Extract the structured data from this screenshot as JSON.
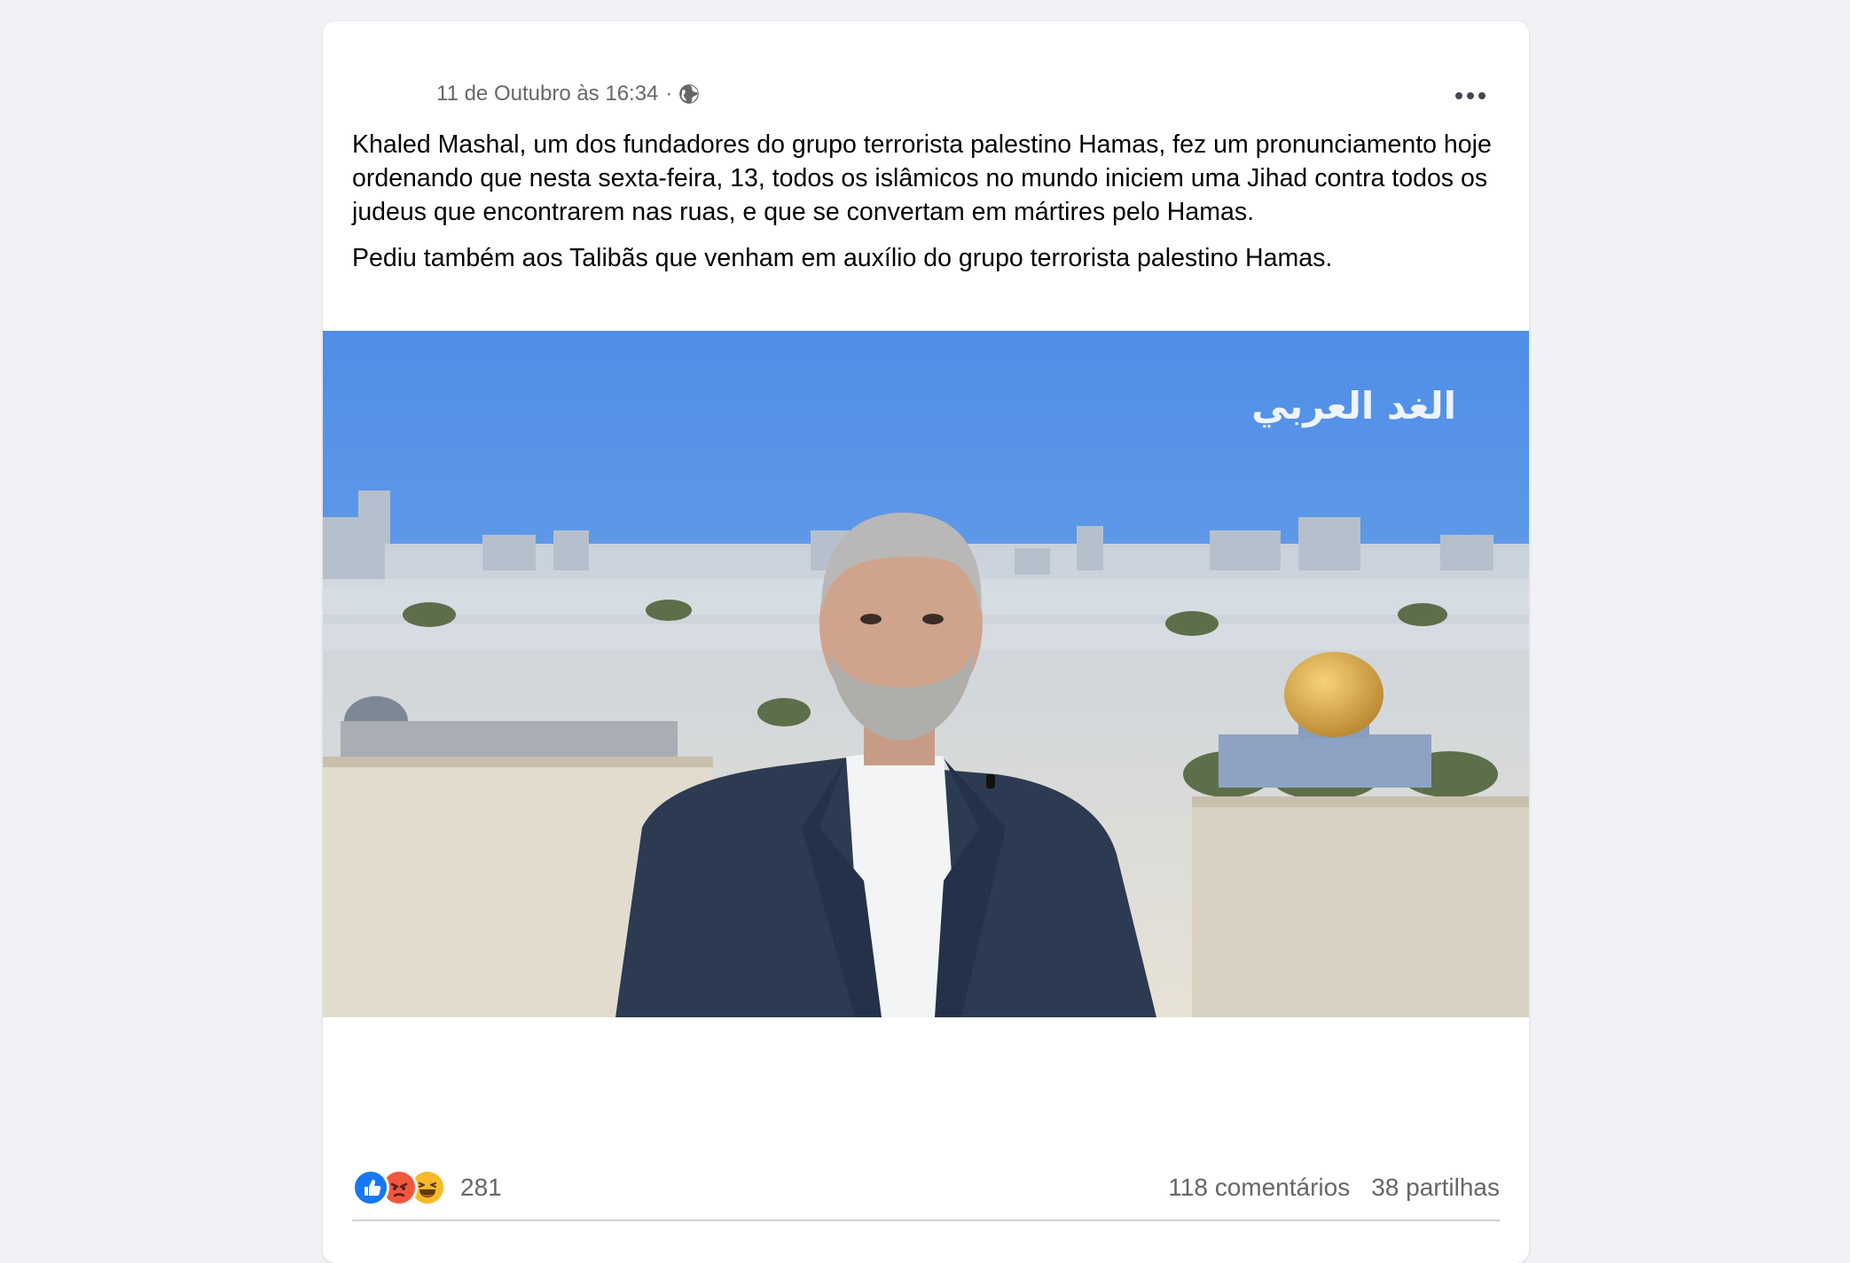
{
  "post": {
    "timestamp": "11 de Outubro às 16:34",
    "separator": "·",
    "privacy_icon": "globe-icon",
    "more_icon": "more-options-icon",
    "paragraphs": [
      "Khaled Mashal, um dos fundadores do grupo terrorista palestino Hamas, fez um pronunciamento hoje ordenando que nesta sexta-feira, 13, todos os islâmicos no mundo iniciem uma Jihad contra todos os judeus que encontrarem nas ruas, e que se convertam em mártires pelo Hamas.",
      "Pediu também aos Talibãs que venham em auxílio do grupo terrorista palestino Hamas."
    ],
    "media": {
      "channel_logo": "الغد العربي"
    }
  },
  "engagement": {
    "reaction_icons": [
      "like-icon",
      "angry-icon",
      "haha-icon"
    ],
    "reaction_count": "281",
    "comments": "118 comentários",
    "shares": "38 partilhas"
  },
  "colors": {
    "background": "#f0f2f5",
    "card": "#ffffff",
    "secondary_text": "#65676b",
    "like_blue": "#1877f2",
    "angry_orange": "#f0573f",
    "haha_yellow": "#f7b928"
  }
}
